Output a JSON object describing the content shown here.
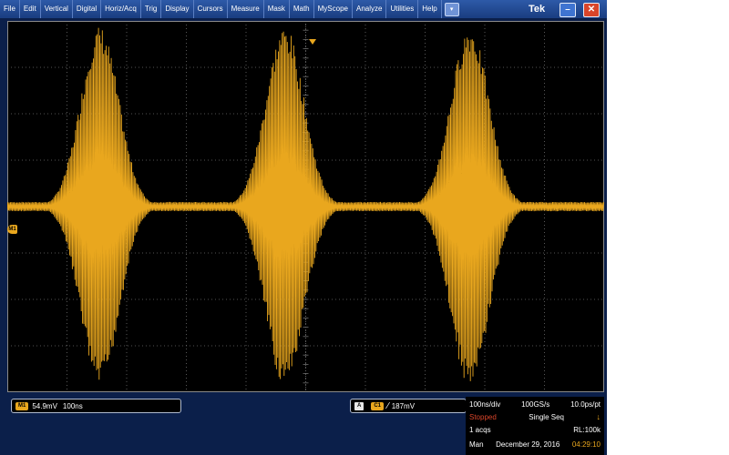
{
  "menu": {
    "items": [
      "File",
      "Edit",
      "Vertical",
      "Digital",
      "Horiz/Acq",
      "Trig",
      "Display",
      "Cursors",
      "Measure",
      "Mask",
      "Math",
      "MyScope",
      "Analyze",
      "Utilities",
      "Help"
    ],
    "dropdown_glyph": "▾"
  },
  "titlebar": {
    "brand": "Tek",
    "minimize_glyph": "–",
    "close_glyph": "✕"
  },
  "scope": {
    "m1_marker": "M1",
    "trace_color": "#e9a71e",
    "grid_color": "#6e6e6e",
    "bursts": {
      "count": 3,
      "centers_div": [
        1.55,
        4.65,
        7.75
      ],
      "peak_div": 3.9,
      "baseline_div": 0.1
    }
  },
  "bottom": {
    "m1": {
      "tag": "M1",
      "scale": "54.9mV",
      "time": "100ns"
    },
    "trigger": {
      "tag_a": "A",
      "tag_ch": "C1",
      "slope_glyph": "∕",
      "level": "187mV"
    },
    "acq": {
      "horiz": "100ns/div",
      "rate": "100GS/s",
      "per_pt": "10.0ps/pt",
      "status": "Stopped",
      "mode": "Single Seq",
      "acqs": "1 acqs",
      "rl": "RL:100k",
      "trig_mode": "Man",
      "date": "December 29, 2016",
      "time": "04:29:10"
    }
  }
}
